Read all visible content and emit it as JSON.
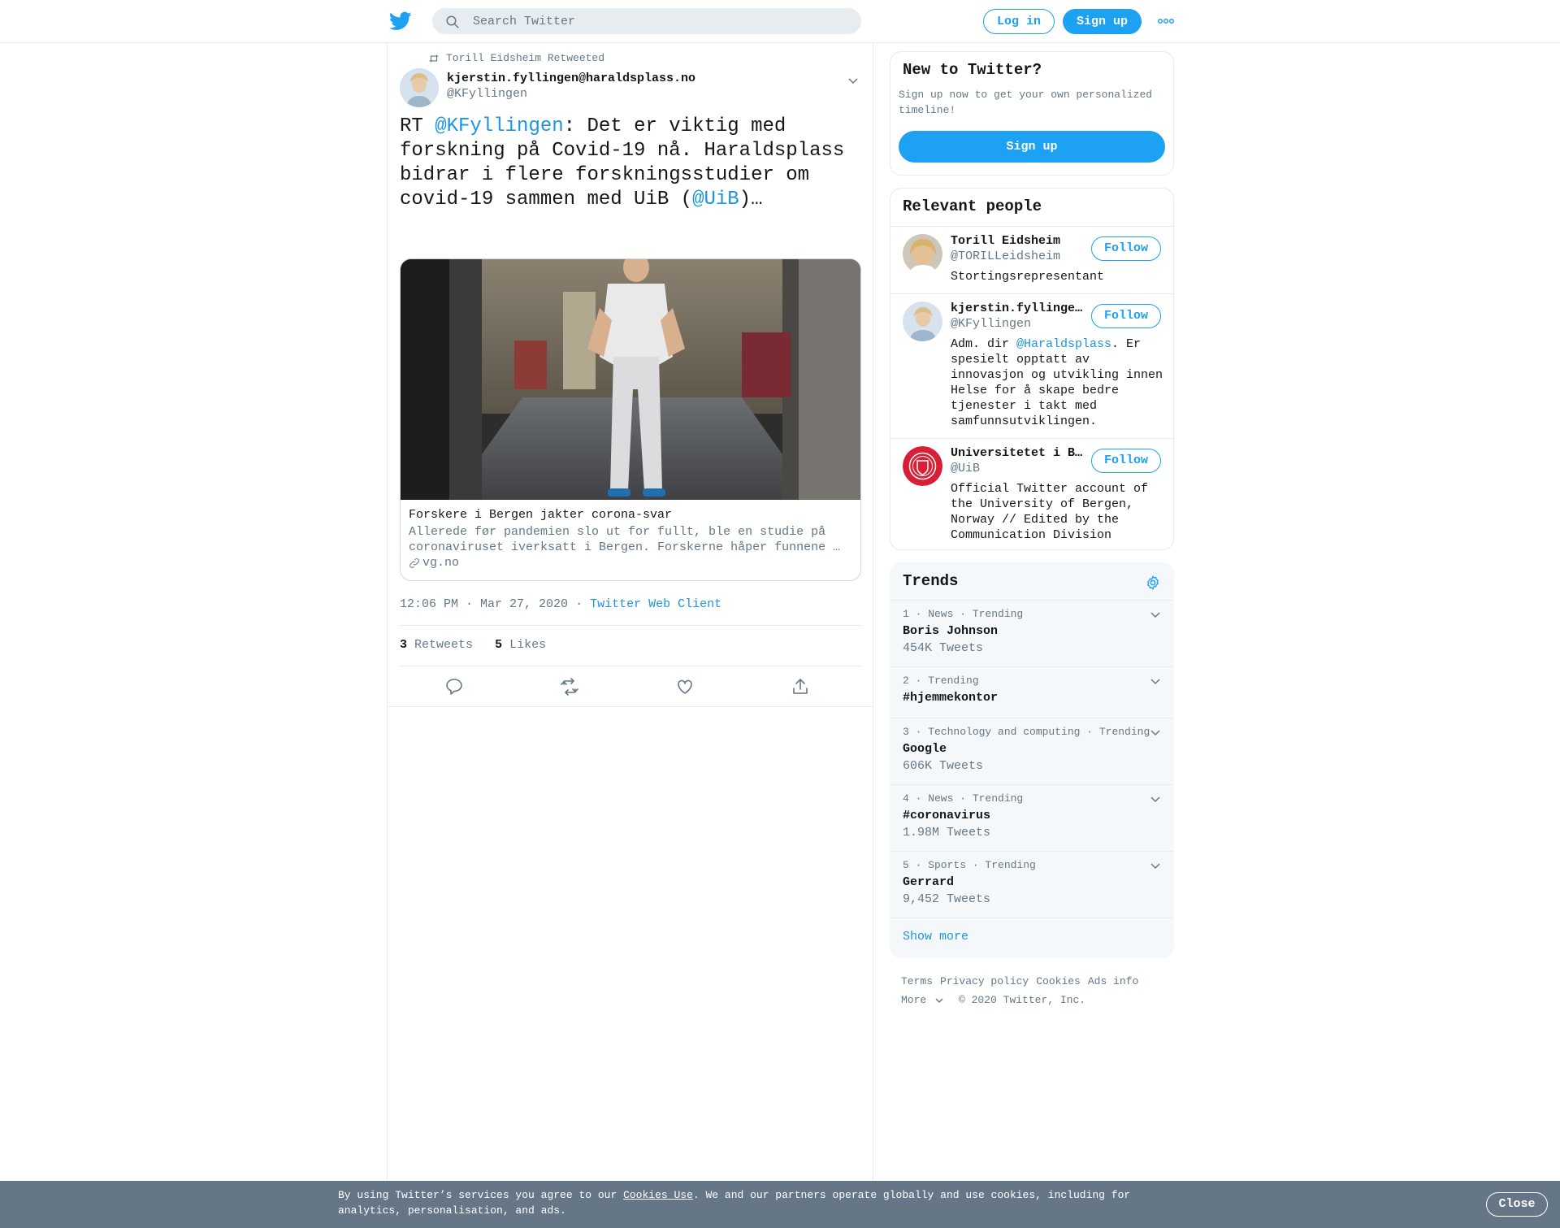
{
  "header": {
    "search_placeholder": "Search Twitter",
    "login_label": "Log in",
    "signup_label": "Sign up"
  },
  "tweet": {
    "retweeted_by": "Torill Eidsheim Retweeted",
    "author_name": "kjerstin.fyllingen@haraldsplass.no",
    "author_handle": "@KFyllingen",
    "text_parts": [
      "RT ",
      "@KFyllingen",
      ": Det er viktig med forskning på Covid-19 nå. Haraldsplass bidrar i flere forskningsstudier om covid-19 sammen med UiB (",
      "@UiB",
      ")…"
    ],
    "card": {
      "title": "Forskere i Bergen jakter corona-svar",
      "description": "Allerede før pandemien slo ut for fullt, ble en studie på coronaviruset iverksatt i Bergen. Forskerne håper funnene …",
      "domain": "vg.no"
    },
    "time": "12:06 PM · Mar 27, 2020",
    "separator": "·",
    "source": "Twitter Web Client",
    "retweets_count": "3",
    "retweets_label": "Retweets",
    "likes_count": "5",
    "likes_label": "Likes"
  },
  "sidebar": {
    "new_to_twitter": {
      "title": "New to Twitter?",
      "subtitle": "Sign up now to get your own personalized timeline!",
      "signup_label": "Sign up"
    },
    "relevant_people": {
      "title": "Relevant people",
      "follow_label": "Follow",
      "people": [
        {
          "name": "Torill Eidsheim",
          "handle": "@TORILLeidsheim",
          "bio": "Stortingsrepresentant"
        },
        {
          "name": "kjerstin.fyllingen@haraldsplass.no",
          "handle": "@KFyllingen",
          "bio_pre": "Adm. dir ",
          "bio_link": "@Haraldsplass",
          "bio_post": ". Er spesielt opptatt av innovasjon og utvikling innen Helse for å skape bedre tjenester i takt med samfunnsutviklingen."
        },
        {
          "name": "Universitetet i Bergen",
          "handle": "@UiB",
          "bio": "Official Twitter account of the University of Bergen, Norway // Edited by the Communication Division"
        }
      ]
    },
    "trends": {
      "title": "Trends",
      "items": [
        {
          "meta": "1 · News · Trending",
          "name": "Boris Johnson",
          "count": "454K Tweets"
        },
        {
          "meta": "2 · Trending",
          "name": "#hjemmekontor",
          "count": ""
        },
        {
          "meta": "3 · Technology and computing · Trending",
          "name": "Google",
          "count": "606K Tweets"
        },
        {
          "meta": "4 · News · Trending",
          "name": "#coronavirus",
          "count": "1.98M Tweets"
        },
        {
          "meta": "5 · Sports · Trending",
          "name": "Gerrard",
          "count": "9,452 Tweets"
        }
      ],
      "show_more": "Show more"
    },
    "footer": {
      "links": [
        "Terms",
        "Privacy policy",
        "Cookies",
        "Ads info"
      ],
      "more": "More",
      "copyright": "© 2020 Twitter, Inc."
    }
  },
  "cookie_bar": {
    "text_pre": "By using Twitter’s services you agree to our ",
    "link": "Cookies Use",
    "text_post": ". We and our partners operate globally and use cookies, including for analytics, personalisation, and ads.",
    "close_label": "Close"
  },
  "colors": {
    "accent": "#1da1f2",
    "link": "#1b95e0",
    "muted": "#657786",
    "cookie_bg": "#657786"
  }
}
